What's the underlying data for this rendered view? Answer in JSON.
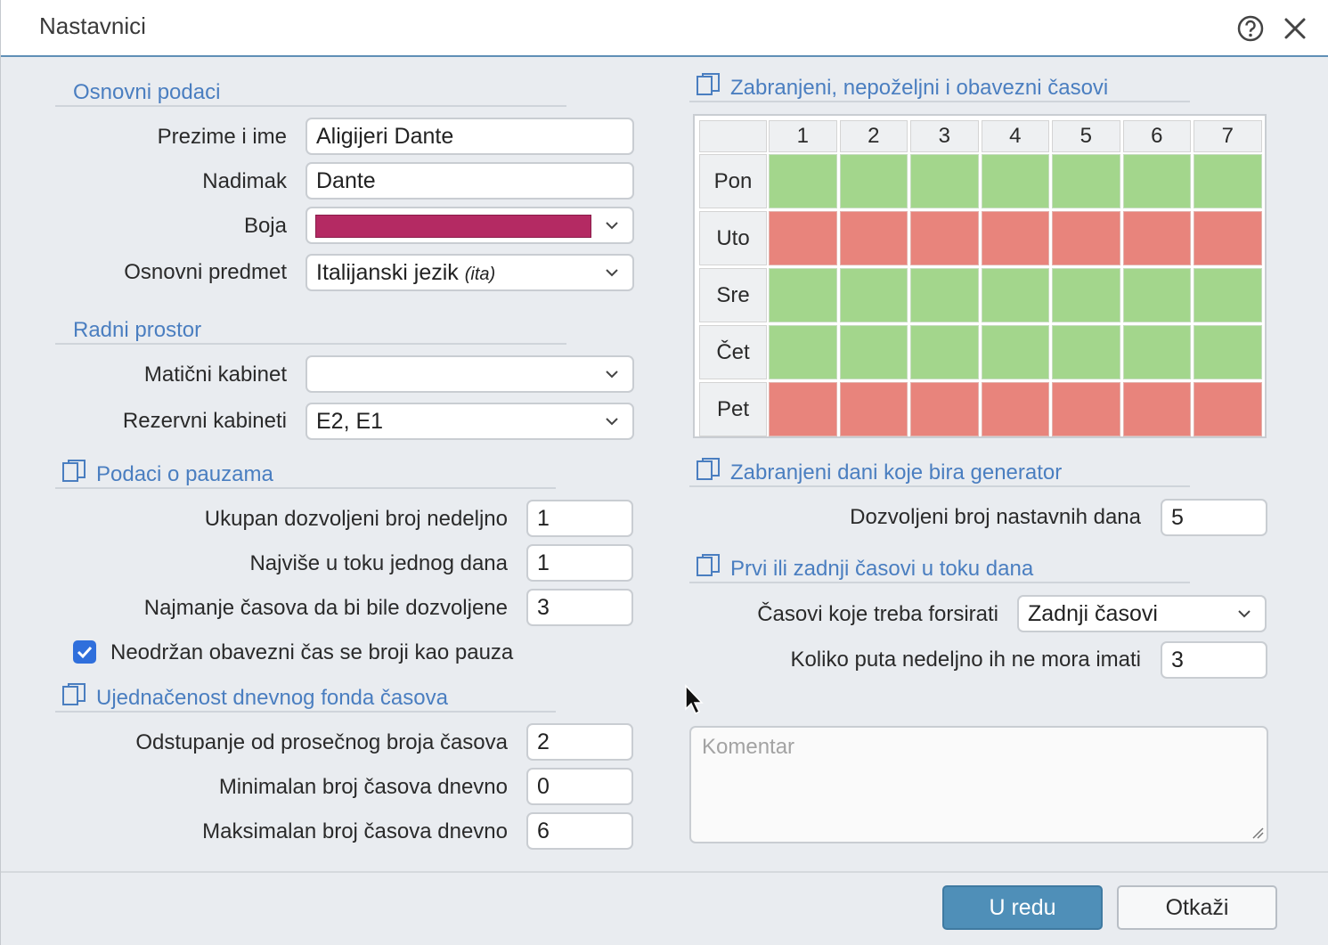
{
  "window": {
    "title": "Nastavnici"
  },
  "sections": {
    "basic": "Osnovni podaci",
    "workspace": "Radni prostor",
    "breaks": "Podaci o pauzama",
    "uniformity": "Ujednačenost dnevnog fonda časova",
    "forbidden": "Zabranjeni, nepoželjni i obavezni časovi",
    "forbidden_days": "Zabranjeni dani koje bira generator",
    "first_last": "Prvi ili zadnji časovi u toku dana"
  },
  "basic": {
    "surname_label": "Prezime i ime",
    "surname_value": "Aligijeri Dante",
    "nickname_label": "Nadimak",
    "nickname_value": "Dante",
    "color_label": "Boja",
    "color_value": "#b42a63",
    "subject_label": "Osnovni predmet",
    "subject_value": "Italijanski jezik",
    "subject_code": "(ita)"
  },
  "workspace": {
    "home_label": "Matični kabinet",
    "home_value": "",
    "reserve_label": "Rezervni kabineti",
    "reserve_value": "E2, E1"
  },
  "breaks": {
    "weekly_label": "Ukupan dozvoljeni broj nedeljno",
    "weekly_value": "1",
    "daily_label": "Najviše u toku jednog dana",
    "daily_value": "1",
    "min_label": "Najmanje časova da bi bile dozvoljene",
    "min_value": "3",
    "checkbox_label": "Neodržan obavezni čas se broji kao pauza",
    "checkbox_checked": true
  },
  "uniformity": {
    "dev_label": "Odstupanje od prosečnog broja časova",
    "dev_value": "2",
    "min_label": "Minimalan broj časova dnevno",
    "min_value": "0",
    "max_label": "Maksimalan broj časova dnevno",
    "max_value": "6"
  },
  "schedule": {
    "periods": [
      "1",
      "2",
      "3",
      "4",
      "5",
      "6",
      "7"
    ],
    "days": [
      "Pon",
      "Uto",
      "Sre",
      "Čet",
      "Pet"
    ],
    "status": [
      [
        "allowed",
        "allowed",
        "allowed",
        "allowed",
        "allowed",
        "allowed",
        "allowed"
      ],
      [
        "forbidden",
        "forbidden",
        "forbidden",
        "forbidden",
        "forbidden",
        "forbidden",
        "forbidden"
      ],
      [
        "allowed",
        "allowed",
        "allowed",
        "allowed",
        "allowed",
        "allowed",
        "allowed"
      ],
      [
        "allowed",
        "allowed",
        "allowed",
        "allowed",
        "allowed",
        "allowed",
        "allowed"
      ],
      [
        "forbidden",
        "forbidden",
        "forbidden",
        "forbidden",
        "forbidden",
        "forbidden",
        "forbidden"
      ]
    ],
    "colors": {
      "allowed": "#a3d68c",
      "forbidden": "#e8847c"
    }
  },
  "forbidden_days": {
    "label": "Dozvoljeni broj nastavnih dana",
    "value": "5"
  },
  "first_last": {
    "force_label": "Časovi koje treba forsirati",
    "force_value": "Zadnji časovi",
    "times_label": "Koliko puta nedeljno ih ne mora imati",
    "times_value": "3"
  },
  "comment": {
    "placeholder": "Komentar"
  },
  "buttons": {
    "ok": "U redu",
    "cancel": "Otkaži"
  }
}
